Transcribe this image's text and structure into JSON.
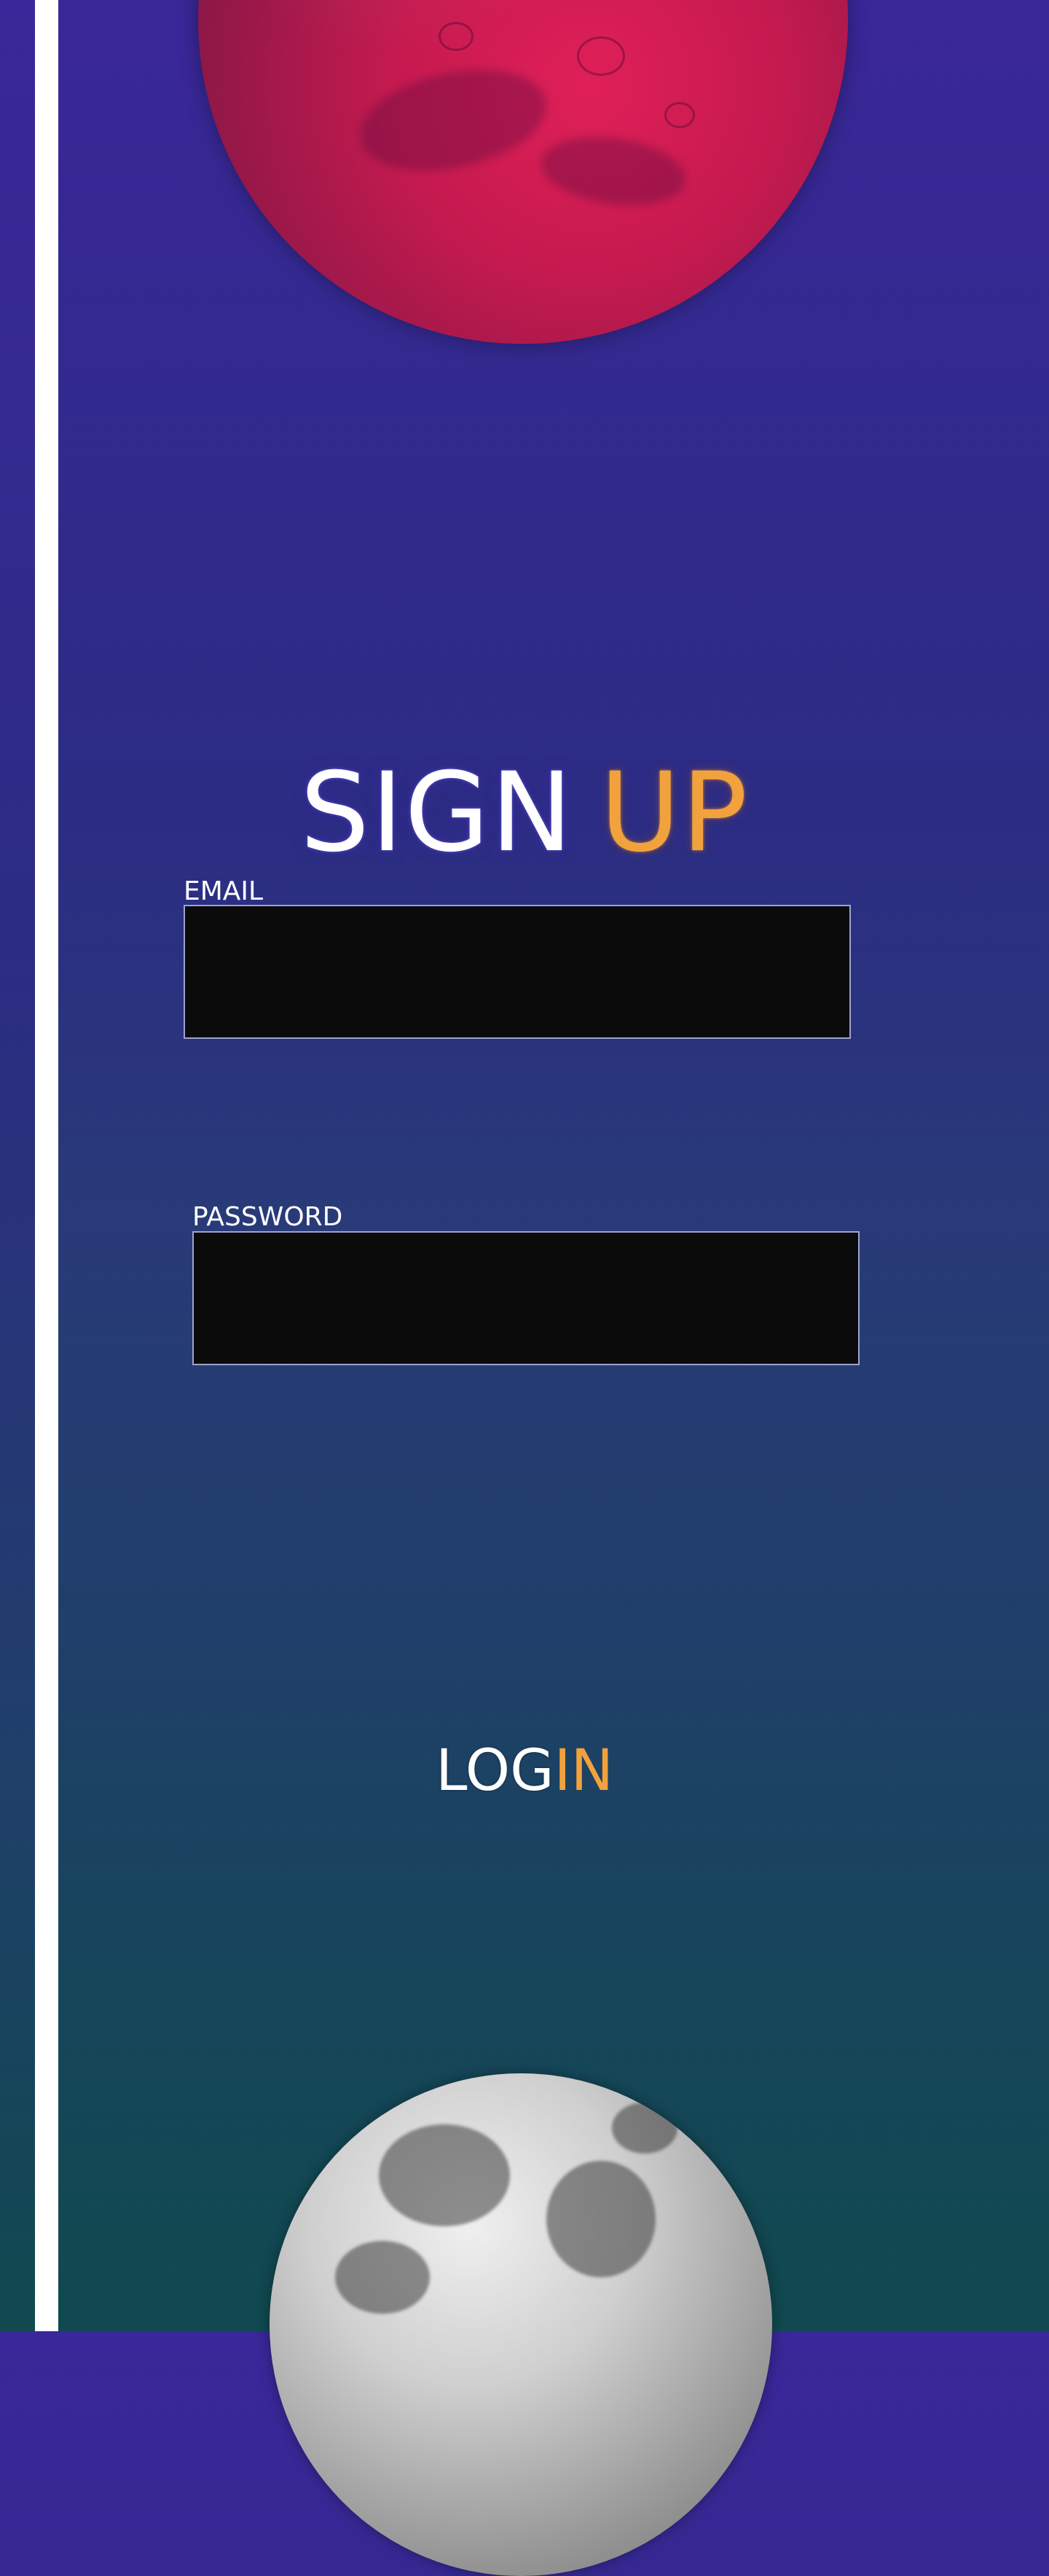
{
  "title": {
    "part1": "SIGN",
    "part2": "UP"
  },
  "form": {
    "email_label": "EMAIL",
    "email_value": "",
    "password_label": "PASSWORD",
    "password_value": ""
  },
  "login_link": {
    "part1": "LOG",
    "part2": "IN"
  },
  "colors": {
    "accent": "#f2a23c",
    "text": "#ffffff",
    "field_background": "#0b0b0b",
    "field_border": "#9ea3cf",
    "gradient_top": "#3a2799",
    "gradient_bottom": "#10494f"
  },
  "images": {
    "top_planet": "mars",
    "bottom_planet": "moon"
  }
}
